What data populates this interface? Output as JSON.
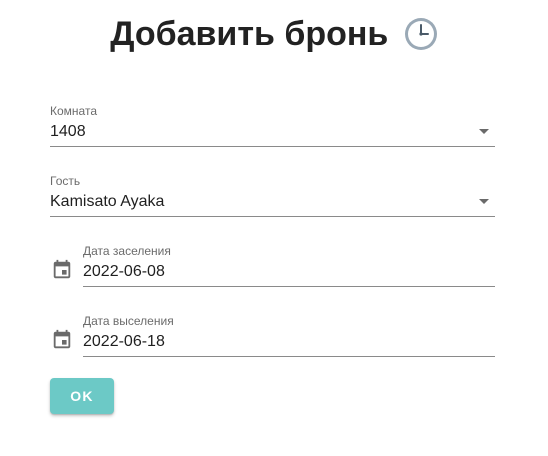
{
  "header": {
    "title": "Добавить бронь",
    "icon": "clock-icon"
  },
  "form": {
    "room": {
      "label": "Комната",
      "value": "1408",
      "icon": "dropdown-arrow-icon"
    },
    "guest": {
      "label": "Гость",
      "value": "Kamisato Ayaka",
      "icon": "dropdown-arrow-icon"
    },
    "checkin": {
      "label": "Дата заселения",
      "value": "2022-06-08",
      "icon": "calendar-icon"
    },
    "checkout": {
      "label": "Дата выселения",
      "value": "2022-06-18",
      "icon": "calendar-icon"
    },
    "submit_label": "OK"
  },
  "colors": {
    "button_bg": "#6cc9c6",
    "button_text": "#ffffff",
    "text": "#222222",
    "label": "#6b6b6b",
    "underline": "#8a8a8a"
  }
}
